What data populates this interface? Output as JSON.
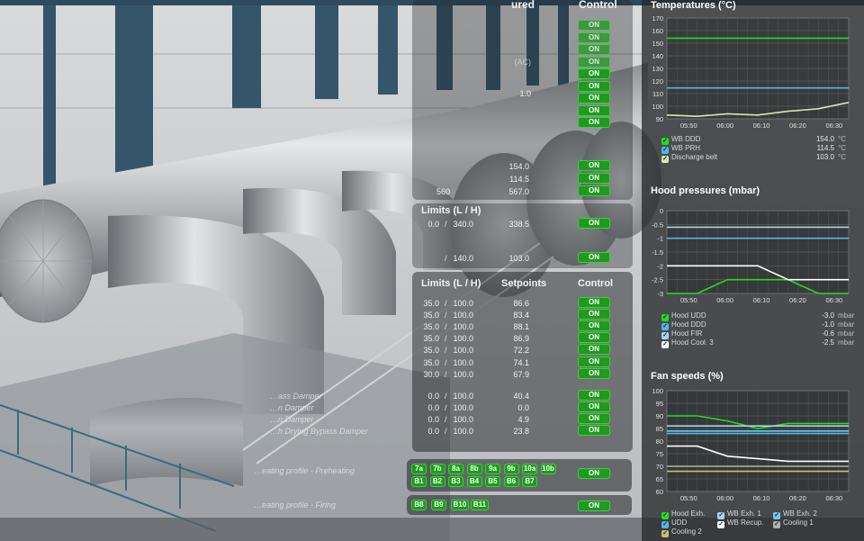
{
  "colors": {
    "on_button": "#1f9a1f",
    "series_green": "#22dd22",
    "series_cyan": "#4fb8e8",
    "series_white": "#ffffff",
    "series_lightblue": "#a8d4f0",
    "series_gray": "#b0b0b0",
    "series_yellow": "#c8c070"
  },
  "top_panel": {
    "header_partial": "ured",
    "control_header": "Control",
    "extra_value": "(AC)",
    "row_value": "1.0",
    "on_buttons": [
      "ON",
      "ON",
      "ON",
      "ON",
      "ON",
      "ON",
      "ON",
      "ON",
      "ON"
    ],
    "rows": [
      {
        "setpoint": "154.0",
        "control": "ON"
      },
      {
        "setpoint": "114.5",
        "control": "ON"
      },
      {
        "setpoint": "567.0",
        "control": "ON",
        "limit": "560"
      }
    ]
  },
  "limits_panel_1": {
    "header": "Limits (L / H)",
    "rows": [
      {
        "low": "0.0",
        "high": "340.0",
        "setpoint": "338.5",
        "control": "ON"
      },
      {
        "low": "",
        "high": "140.0",
        "setpoint": "103.0",
        "control": "ON"
      }
    ]
  },
  "main_panel": {
    "limits_header": "Limits (L / H)",
    "setpoints_header": "Setpoints",
    "control_header": "Control",
    "rows": [
      {
        "label": "",
        "low": "35.0",
        "high": "100.0",
        "setpoint": "86.6",
        "control": "ON"
      },
      {
        "label": "",
        "low": "35.0",
        "high": "100.0",
        "setpoint": "83.4",
        "control": "ON"
      },
      {
        "label": "",
        "low": "35.0",
        "high": "100.0",
        "setpoint": "88.1",
        "control": "ON"
      },
      {
        "label": "",
        "low": "35.0",
        "high": "100.0",
        "setpoint": "86.9",
        "control": "ON"
      },
      {
        "label": "",
        "low": "35.0",
        "high": "100.0",
        "setpoint": "72.2",
        "control": "ON"
      },
      {
        "label": "",
        "low": "35.0",
        "high": "100.0",
        "setpoint": "74.1",
        "control": "ON"
      },
      {
        "label": "",
        "low": "30.0",
        "high": "100.0",
        "setpoint": "67.9",
        "control": "ON"
      },
      {
        "label": "…ass Damper",
        "low": "0.0",
        "high": "100.0",
        "setpoint": "40.4",
        "control": "ON"
      },
      {
        "label": "…n Damper",
        "low": "0.0",
        "high": "100.0",
        "setpoint": "0.0",
        "control": "ON"
      },
      {
        "label": "…n Damper",
        "low": "0.0",
        "high": "100.0",
        "setpoint": "4.9",
        "control": "ON"
      },
      {
        "label": "…h Drying Bypass Damper",
        "low": "0.0",
        "high": "100.0",
        "setpoint": "23.8",
        "control": "ON"
      }
    ]
  },
  "profiles": [
    {
      "label": "…eating profile - Preheating",
      "tags_row1": [
        "7a",
        "7b",
        "8a",
        "8b",
        "9a",
        "9b",
        "10a",
        "10b"
      ],
      "tags_row2": [
        "B1",
        "B2",
        "B3",
        "B4",
        "B5",
        "B6",
        "B7"
      ],
      "control": "ON"
    },
    {
      "label": "…eating profile - Firing",
      "tags_row1": [
        "B8",
        "B9",
        "B10",
        "B11"
      ],
      "control": "ON"
    }
  ],
  "charts": [
    {
      "title": "Temperatures (°C)",
      "chart_data": {
        "type": "line",
        "x": [
          "05:50",
          "06:00",
          "06:10",
          "06:20",
          "06:30"
        ],
        "ylim": [
          90,
          170
        ],
        "yticks": [
          "170",
          "160",
          "150",
          "140",
          "130",
          "120",
          "110",
          "100",
          "90"
        ],
        "series": [
          {
            "name": "WB DDD",
            "value": "154.0",
            "unit": "°C",
            "color": "#22dd22",
            "values": [
              154,
              154,
              154,
              154,
              154,
              154
            ]
          },
          {
            "name": "WB PRH",
            "value": "114.5",
            "unit": "°C",
            "color": "#4fb8e8",
            "values": [
              114.5,
              114.5,
              114.5,
              114.5,
              114.5,
              114.5
            ]
          },
          {
            "name": "Discharge belt",
            "value": "103.0",
            "unit": "°C",
            "color": "#d8e8b0",
            "values": [
              93,
              92,
              94,
              93,
              96,
              98,
              103
            ]
          }
        ]
      }
    },
    {
      "title": "Hood pressures (mbar)",
      "chart_data": {
        "type": "line",
        "x": [
          "05:50",
          "06:00",
          "06:10",
          "06:20",
          "06:30"
        ],
        "ylim": [
          -3,
          0
        ],
        "yticks": [
          "0",
          "-0.5",
          "-1",
          "-1.5",
          "-2",
          "-2.5",
          "-3"
        ],
        "series": [
          {
            "name": "Hood UDD",
            "value": "-3.0",
            "unit": "mbar",
            "color": "#22dd22",
            "values": [
              -3,
              -3,
              -2.5,
              -2.5,
              -2.5,
              -3,
              -3
            ]
          },
          {
            "name": "Hood DDD",
            "value": "-1.0",
            "unit": "mbar",
            "color": "#4fb8e8",
            "values": [
              -1,
              -1,
              -1,
              -1,
              -1,
              -1,
              -1
            ]
          },
          {
            "name": "Hood FIR",
            "value": "-0.6",
            "unit": "mbar",
            "color": "#a8d4f0",
            "values": [
              -0.6,
              -0.6,
              -0.6,
              -0.6,
              -0.6,
              -0.6,
              -0.6
            ]
          },
          {
            "name": "Hood Cool. 3",
            "value": "-2.5",
            "unit": "mbar",
            "color": "#ffffff",
            "values": [
              -2,
              -2,
              -2,
              -2,
              -2.5,
              -2.5,
              -2.5
            ]
          }
        ]
      }
    },
    {
      "title": "Fan speeds (%)",
      "chart_data": {
        "type": "line",
        "x": [
          "05:50",
          "06:00",
          "06:10",
          "06:20",
          "06:30"
        ],
        "ylim": [
          60,
          100
        ],
        "yticks": [
          "100",
          "95",
          "90",
          "85",
          "80",
          "75",
          "70",
          "65",
          "60"
        ],
        "series": [
          {
            "name": "Hood Exh.",
            "color": "#22dd22",
            "values": [
              90,
              90,
              88,
              85,
              87,
              87,
              87
            ]
          },
          {
            "name": "WB Exh. 1",
            "color": "#a8d4f0",
            "values": [
              86,
              86,
              86,
              86,
              86,
              86,
              86
            ]
          },
          {
            "name": "WB Exh. 2",
            "color": "#6fc8f0",
            "values": [
              84,
              84,
              84,
              84,
              84,
              84,
              84
            ]
          },
          {
            "name": "UDD",
            "color": "#4fb8e8",
            "values": [
              83,
              83,
              83,
              83,
              83,
              83,
              83
            ]
          },
          {
            "name": "WB Recup.",
            "color": "#ffffff",
            "values": [
              78,
              78,
              74,
              73,
              72,
              72,
              72
            ]
          },
          {
            "name": "Cooling 1",
            "color": "#b0b0b0",
            "values": [
              70,
              70,
              70,
              70,
              70,
              70,
              70
            ]
          },
          {
            "name": "Cooling 2",
            "color": "#c8c070",
            "values": [
              68,
              68,
              68,
              68,
              68,
              68,
              68
            ]
          }
        ]
      }
    }
  ]
}
